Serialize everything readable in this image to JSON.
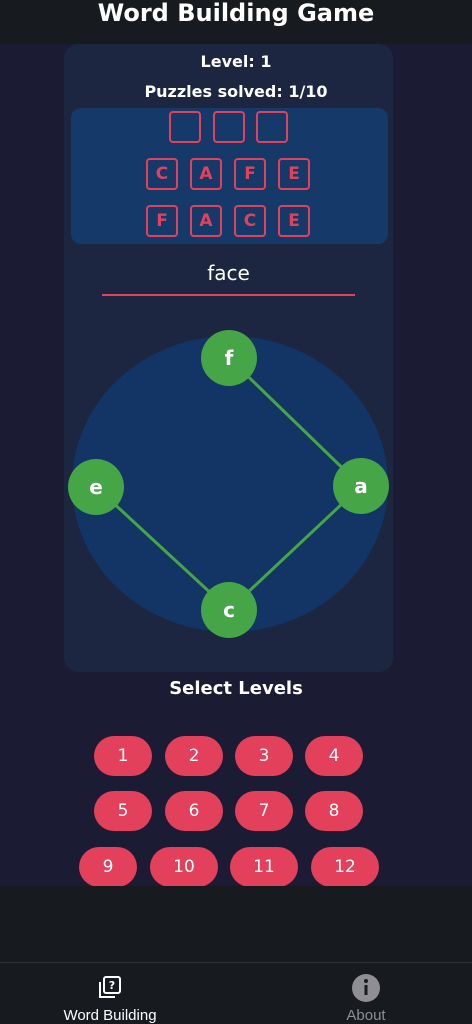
{
  "header": {
    "title": "Word Building Game"
  },
  "stats": {
    "level": "Level: 1",
    "solved": "Puzzles solved: 1/10"
  },
  "board": {
    "rows": [
      [
        "",
        "",
        ""
      ],
      [
        "C",
        "A",
        "F",
        "E"
      ],
      [
        "F",
        "A",
        "C",
        "E"
      ]
    ]
  },
  "current_word": "face",
  "wheel": {
    "letters": [
      "f",
      "a",
      "c",
      "e"
    ],
    "selected_path": [
      "f",
      "a",
      "c",
      "e"
    ]
  },
  "levels": {
    "title": "Select Levels",
    "items": [
      "1",
      "2",
      "3",
      "4",
      "5",
      "6",
      "7",
      "8",
      "9",
      "10",
      "11",
      "12"
    ]
  },
  "tabbar": {
    "tabs": [
      {
        "label": "Word Building",
        "icon": "puzzle-cards-icon",
        "active": true
      },
      {
        "label": "About",
        "icon": "info-icon",
        "active": false
      }
    ]
  },
  "colors": {
    "accent": "#e3415b",
    "node": "#45a547",
    "card": "#1c2641",
    "board": "#153a6a"
  }
}
